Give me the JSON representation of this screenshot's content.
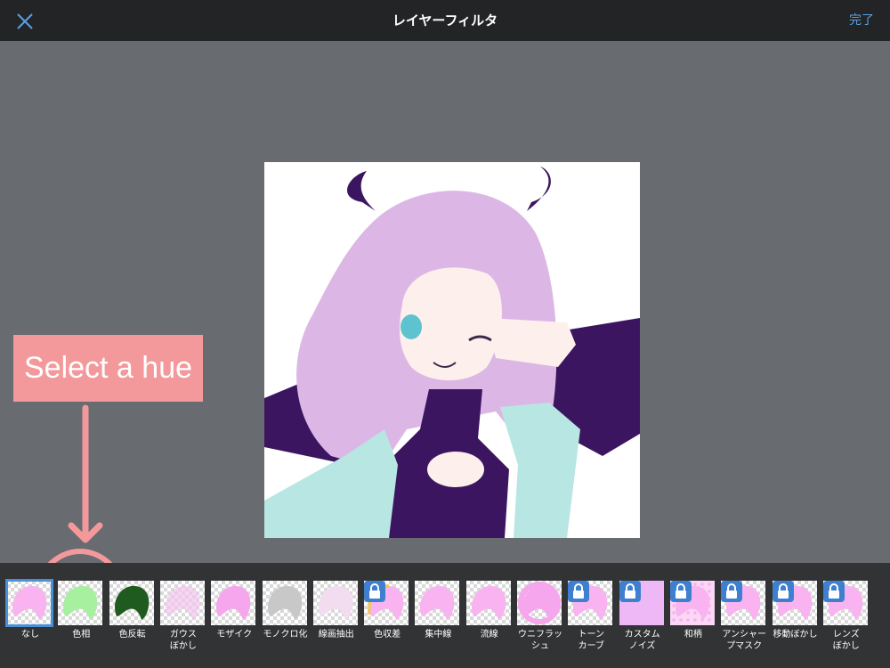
{
  "header": {
    "title": "レイヤーフィルタ",
    "done_label": "完了",
    "close_icon": "close-icon"
  },
  "annotation": {
    "callout_text": "Select a hue"
  },
  "colors": {
    "accent": "#5b9fe0",
    "callout": "#f4999b",
    "selection": "#4a90d9"
  },
  "filters": [
    {
      "label": "なし",
      "locked": false,
      "selected": true
    },
    {
      "label": "色相",
      "locked": false
    },
    {
      "label": "色反転",
      "locked": false
    },
    {
      "label": "ガウス\nぼかし",
      "locked": false
    },
    {
      "label": "モザイク",
      "locked": false
    },
    {
      "label": "モノクロ化",
      "locked": false
    },
    {
      "label": "線画抽出",
      "locked": false
    },
    {
      "label": "色収差",
      "locked": true
    },
    {
      "label": "集中線",
      "locked": false
    },
    {
      "label": "流線",
      "locked": false
    },
    {
      "label": "ウニフラッ\nシュ",
      "locked": false
    },
    {
      "label": "トーン\nカーブ",
      "locked": true
    },
    {
      "label": "カスタム\nノイズ",
      "locked": true
    },
    {
      "label": "和柄",
      "locked": true
    },
    {
      "label": "アンシャー\nプマスク",
      "locked": true
    },
    {
      "label": "移動ぼかし",
      "locked": true
    },
    {
      "label": "レンズ\nぼかし",
      "locked": true
    }
  ]
}
